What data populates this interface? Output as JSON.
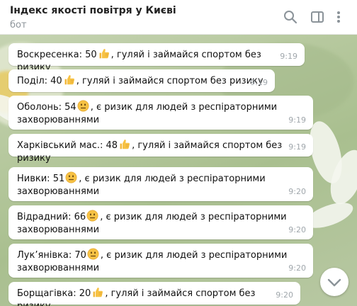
{
  "header": {
    "title": "Індекс якості повітря у Києві",
    "subtitle": "бот"
  },
  "icons": {
    "search": "search-icon",
    "sidebar": "sidebar-toggle-icon",
    "menu": "more-vertical-icon",
    "good": "thumbs-up-emoji",
    "moderate": "neutral-face-emoji",
    "scroll": "chevron-down-icon"
  },
  "colors": {
    "bubble": "#ffffff",
    "time": "#a0a7ac",
    "emoji_yellow": "#f7c244"
  },
  "messages": [
    {
      "district": "Воскресенка",
      "aqi": "50",
      "emoji": "thumbs-up-emoji",
      "text": "Воскресенка: 50",
      "rest": ", гуляй і займайся спортом без ризику",
      "time": "9:19"
    },
    {
      "district": "Поділ",
      "aqi": "40",
      "emoji": "thumbs-up-emoji",
      "text": "Поділ: 40",
      "rest": ", гуляй і займайся спортом без ризику",
      "time": "9:19"
    },
    {
      "district": "Оболонь",
      "aqi": "54",
      "emoji": "neutral-face-emoji",
      "text": "Оболонь: 54",
      "rest": ", є ризик для людей з респіраторними",
      "rest2": "захворюваннями",
      "time": "9:19"
    },
    {
      "district": "Харківський мас.",
      "aqi": "48",
      "emoji": "thumbs-up-emoji",
      "text": "Харківський мас.: 48",
      "rest": ", гуляй і займайся спортом без ризику",
      "time": "9:19"
    },
    {
      "district": "Нивки",
      "aqi": "51",
      "emoji": "neutral-face-emoji",
      "text": "Нивки: 51",
      "rest": ", є ризик для людей з респіраторними",
      "rest2": "захворюваннями",
      "time": "9:20"
    },
    {
      "district": "Відрадний",
      "aqi": "66",
      "emoji": "neutral-face-emoji",
      "text": "Відрадний: 66",
      "rest": ", є ризик для людей з респіраторними",
      "rest2": "захворюваннями",
      "time": "9:20"
    },
    {
      "district": "Лук'янівка",
      "aqi": "70",
      "emoji": "neutral-face-emoji",
      "text": "Лук’янівка: 70",
      "rest": ", є ризик для людей з респіраторними",
      "rest2": "захворюваннями",
      "time": "9:20"
    },
    {
      "district": "Борщагівка",
      "aqi": "20",
      "emoji": "thumbs-up-emoji",
      "text": "Борщагівка: 20",
      "rest": ", гуляй і займайся спортом без ризику",
      "time": "9:20"
    }
  ]
}
